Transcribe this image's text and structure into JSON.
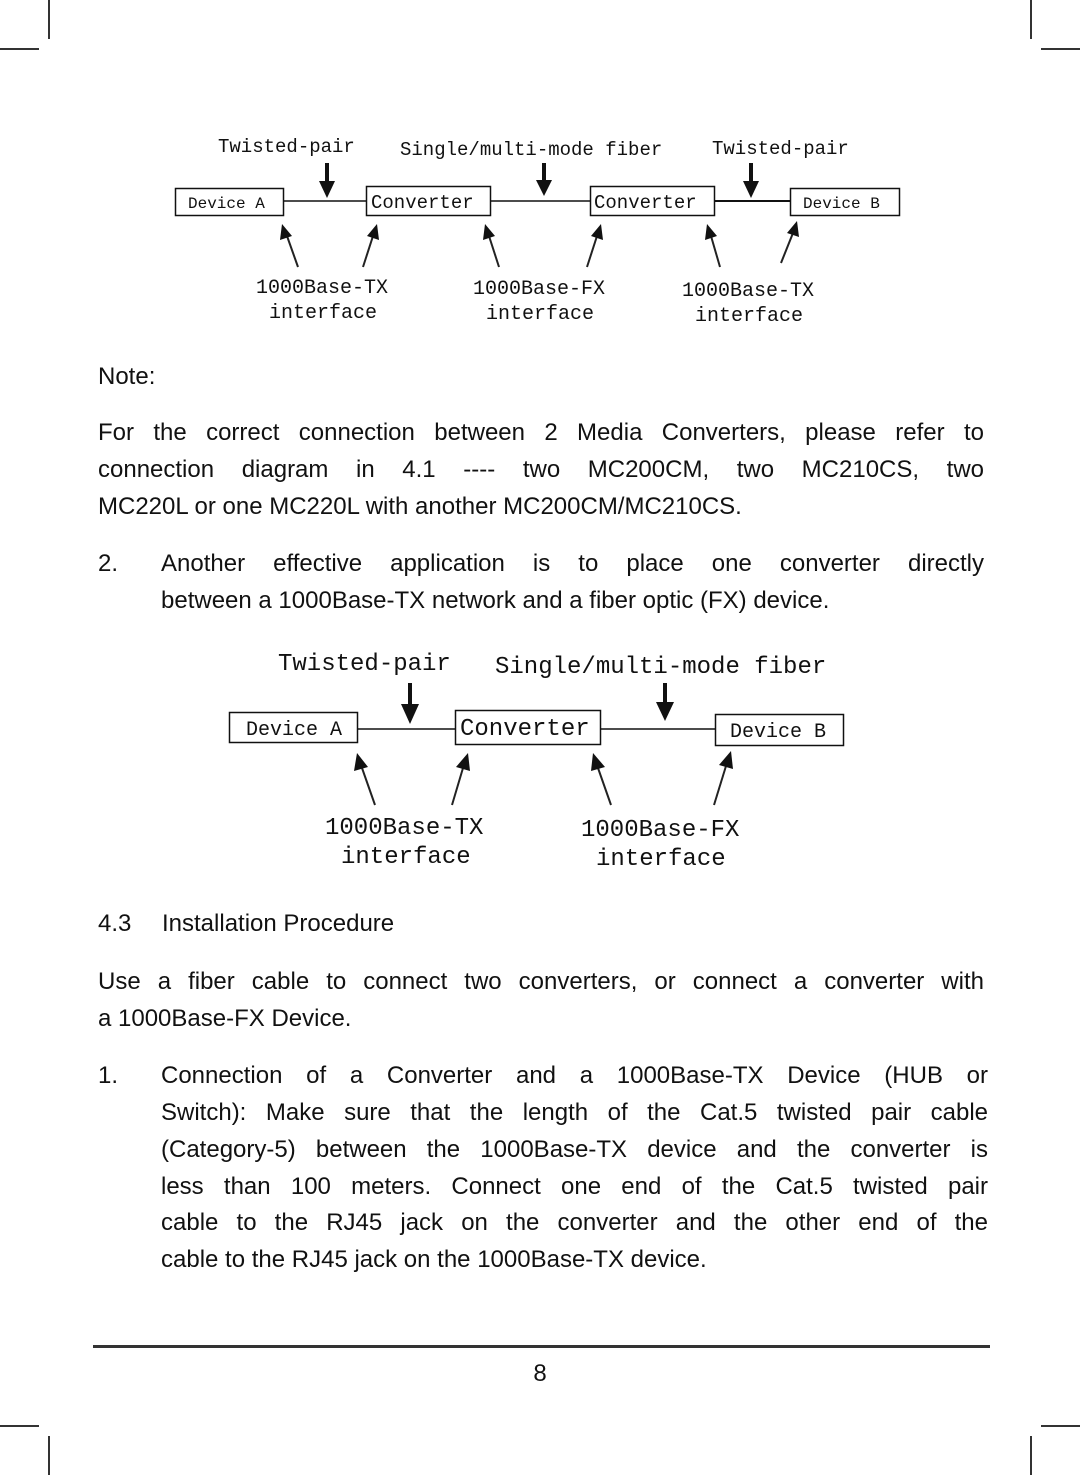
{
  "diagram1": {
    "top_labels": [
      "Twisted-pair",
      "Single/multi-mode fiber",
      "Twisted-pair"
    ],
    "boxes": [
      "Device A",
      "Converter",
      "Converter",
      "Device B"
    ],
    "bottom_labels": [
      {
        "line1": "1000Base-TX",
        "line2": "interface"
      },
      {
        "line1": "1000Base-FX",
        "line2": "interface"
      },
      {
        "line1": "1000Base-TX",
        "line2": "interface"
      }
    ]
  },
  "note": {
    "heading": "Note:",
    "lines": [
      "For the correct connection between 2 Media Converters, please refer to",
      "connection diagram in 4.1 ---- two MC200CM, two MC210CS, two",
      "MC220L or one MC220L with another MC200CM/MC210CS."
    ]
  },
  "item2": {
    "number": "2.",
    "lines": [
      "Another effective application is to place one converter directly",
      "between a 1000Base-TX network and a fiber optic (FX) device."
    ]
  },
  "diagram2": {
    "top_labels": [
      "Twisted-pair",
      "Single/multi-mode fiber"
    ],
    "boxes": [
      "Device A",
      "Converter",
      "Device B"
    ],
    "bottom_labels": [
      {
        "line1": "1000Base-TX",
        "line2": "interface"
      },
      {
        "line1": "1000Base-FX",
        "line2": "interface"
      }
    ]
  },
  "section": {
    "number": "4.3",
    "title": "Installation Procedure",
    "intro_lines": [
      "Use a fiber cable to connect two converters, or connect a converter with",
      "a 1000Base-FX Device."
    ]
  },
  "item1": {
    "number": "1.",
    "lines": [
      "Connection of a Converter and a 1000Base-TX Device (HUB or",
      "Switch): Make sure that the length of the Cat.5 twisted pair cable",
      "(Category-5) between the 1000Base-TX device and the converter is",
      "less than 100 meters. Connect one end of the Cat.5 twisted pair",
      "cable to the RJ45 jack on the converter and the other end of the",
      "cable to the RJ45 jack on the 1000Base-TX device."
    ]
  },
  "footer": {
    "page_number": "8"
  }
}
